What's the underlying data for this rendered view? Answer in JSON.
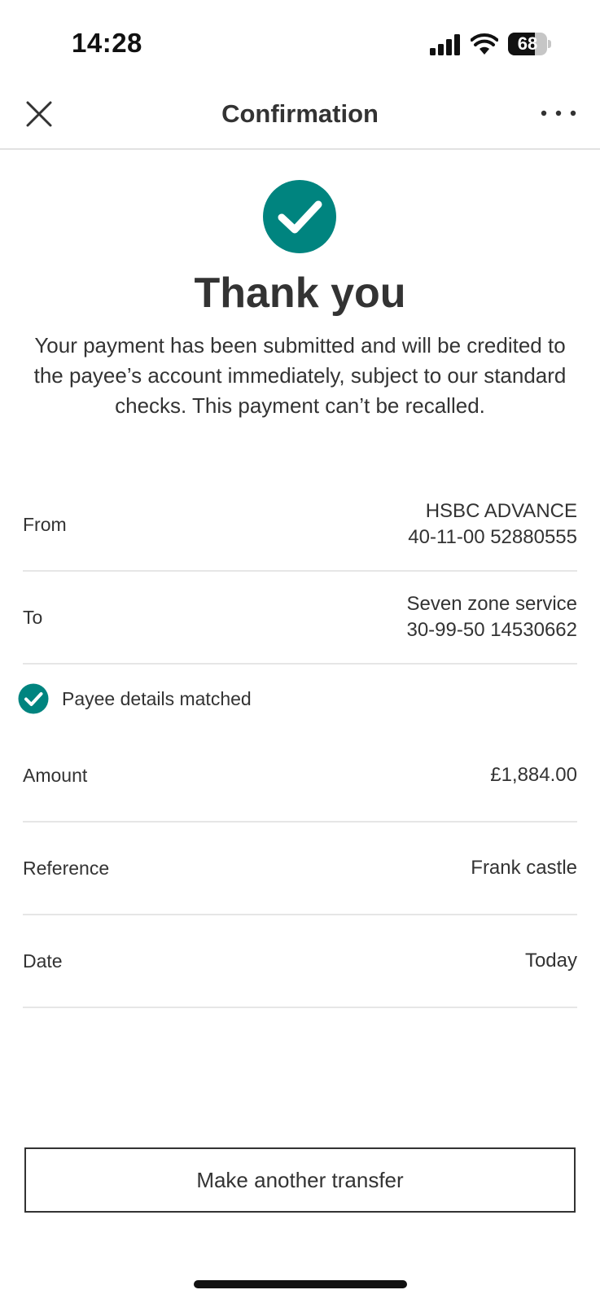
{
  "status_bar": {
    "time": "14:28",
    "battery_level": "68",
    "battery_fraction": 0.68
  },
  "nav": {
    "title": "Confirmation",
    "close_icon": "close-icon",
    "more_icon": "more-horizontal-icon"
  },
  "success": {
    "icon": "check-circle-icon",
    "title": "Thank you",
    "message": "Your payment has been submitted and will be credited to the payee’s account immediately, subject to our standard checks. This payment can’t be recalled."
  },
  "details": {
    "from": {
      "label": "From",
      "account_name": "HSBC ADVANCE",
      "account_number": "40-11-00 52880555"
    },
    "to": {
      "label": "To",
      "payee_name": "Seven zone service",
      "account_number": "30-99-50 14530662"
    },
    "payee_match": {
      "icon": "check-circle-icon",
      "text": "Payee details matched"
    },
    "amount": {
      "label": "Amount",
      "value": "£1,884.00"
    },
    "reference": {
      "label": "Reference",
      "value": "Frank castle"
    },
    "date": {
      "label": "Date",
      "value": "Today"
    }
  },
  "actions": {
    "make_another_label": "Make another transfer"
  },
  "colors": {
    "accent": "#00847f",
    "text": "#333333",
    "divider": "#e6e6e6"
  }
}
